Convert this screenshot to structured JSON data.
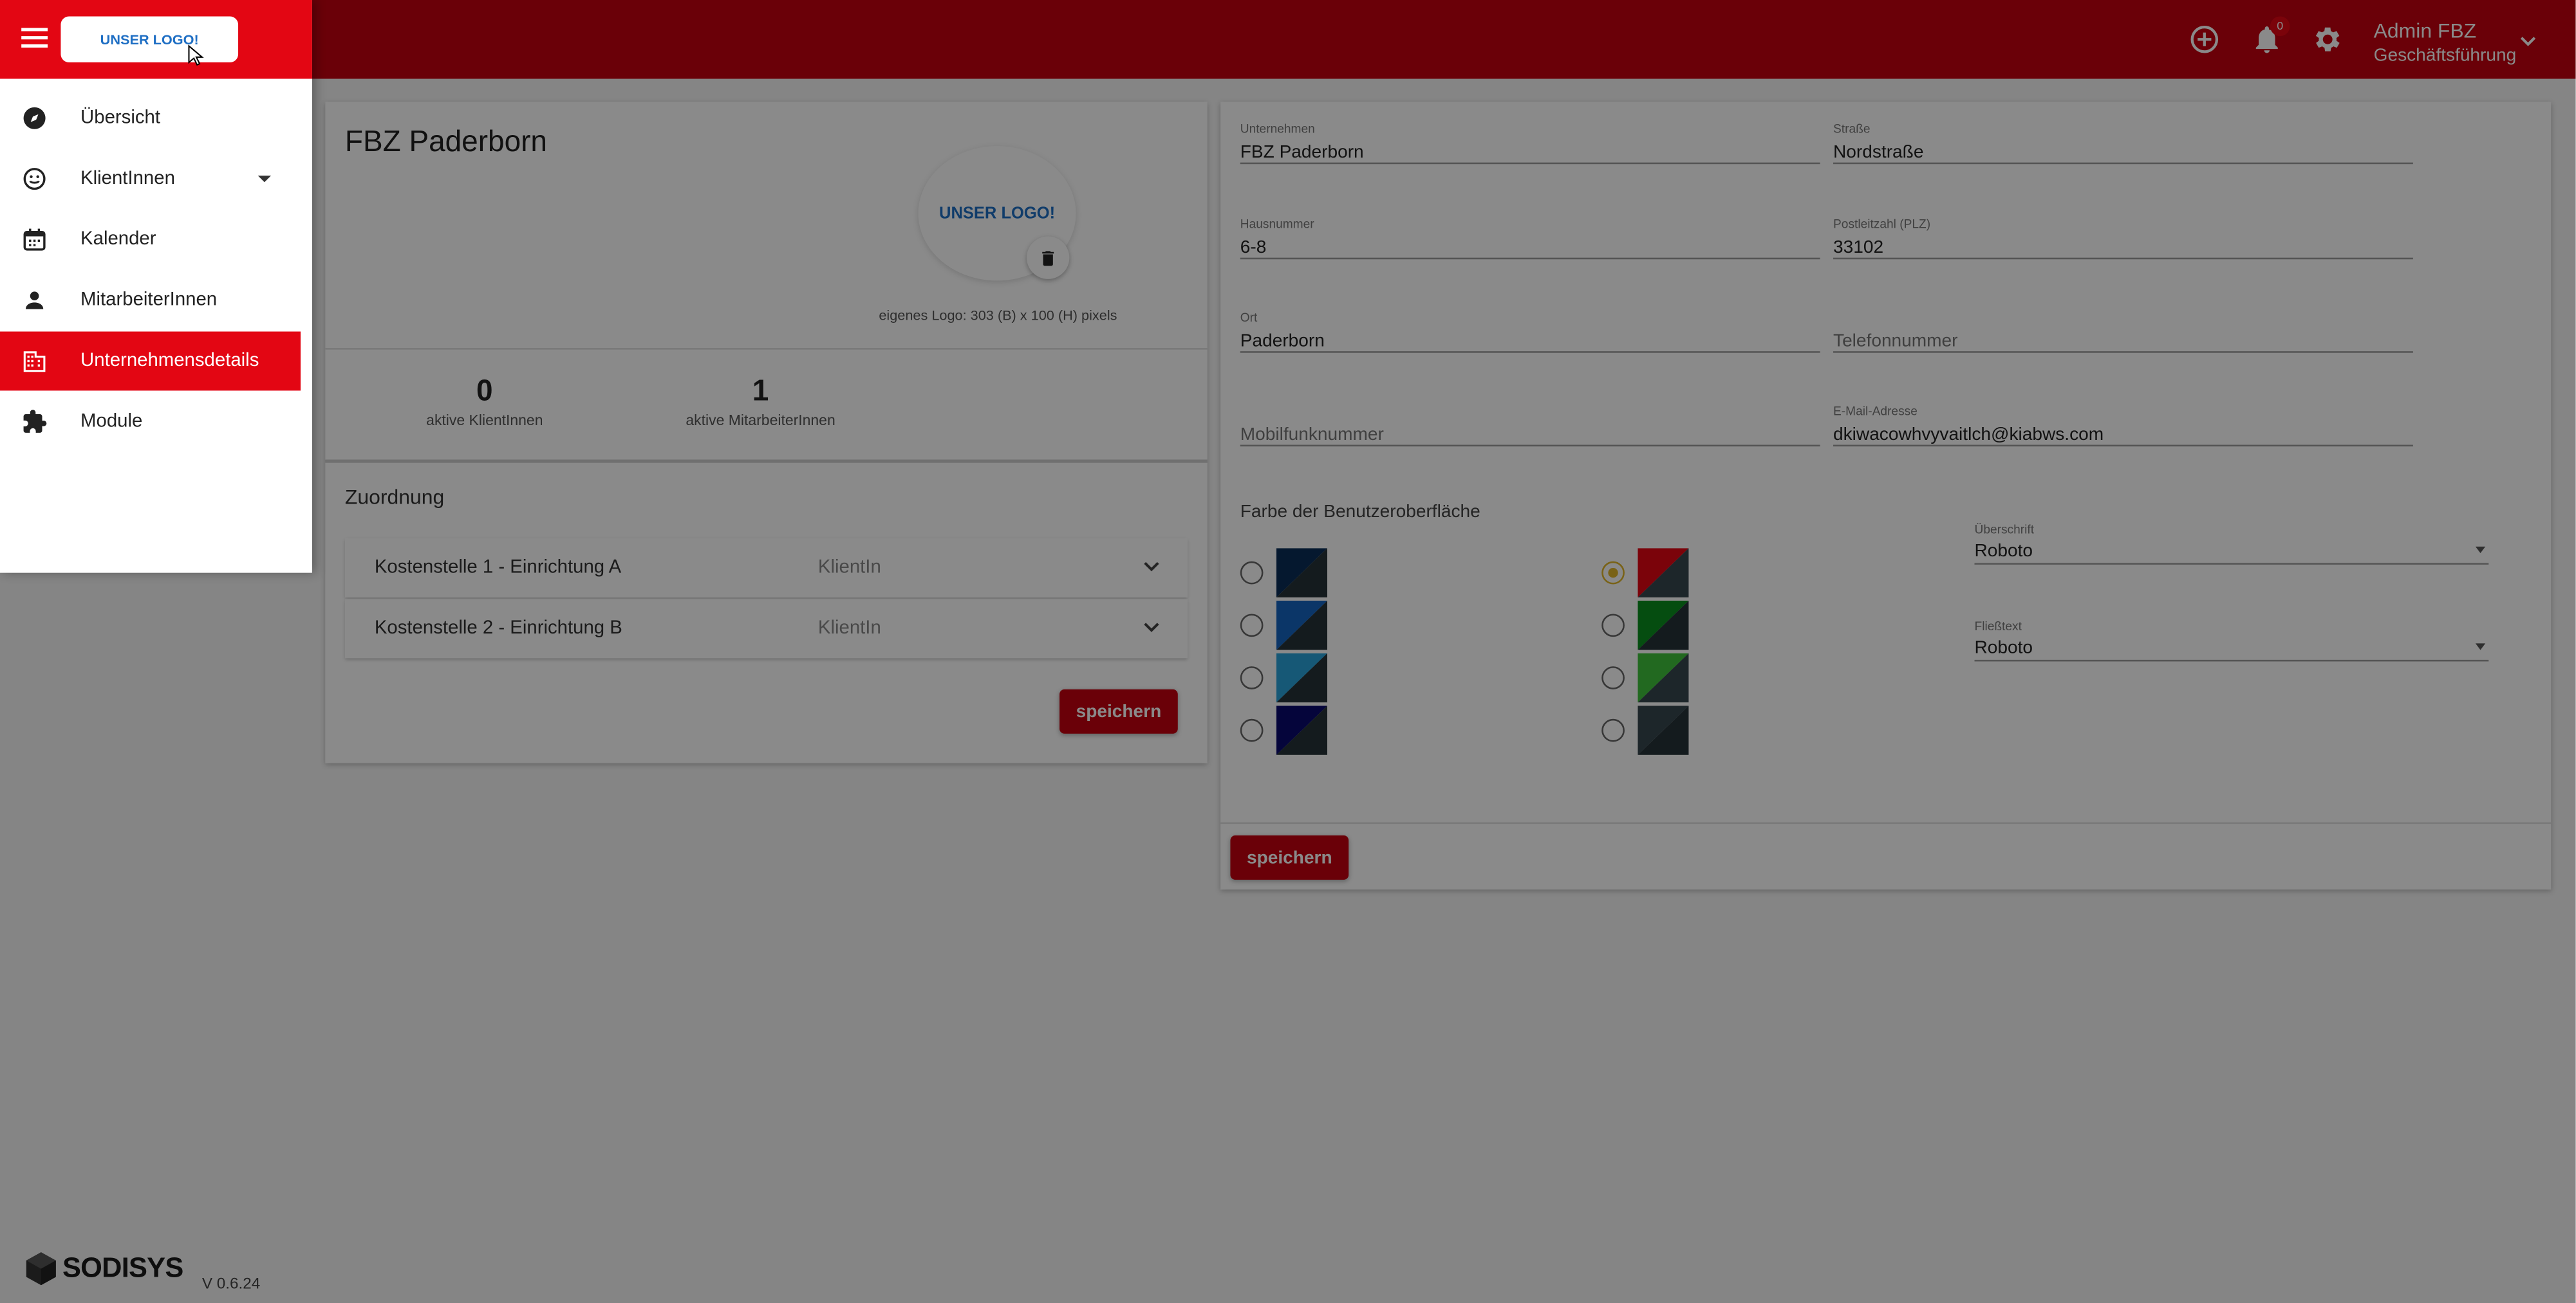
{
  "app": {
    "logo_text": "UNSER LOGO!",
    "brand_name": "SODISYS",
    "version": "V 0.6.24"
  },
  "topbar": {
    "notification_count": "0",
    "user_name": "Admin FBZ",
    "user_role": "Geschäftsführung",
    "icons": [
      "add-circle-icon",
      "bell-icon",
      "gear-icon",
      "chevron-down-icon"
    ]
  },
  "sidebar": {
    "items": [
      {
        "label": "Übersicht",
        "icon": "compass-icon",
        "active": false
      },
      {
        "label": "KlientInnen",
        "icon": "smiley-icon",
        "active": false,
        "has_submenu": true
      },
      {
        "label": "Kalender",
        "icon": "calendar-icon",
        "active": false
      },
      {
        "label": "MitarbeiterInnen",
        "icon": "person-icon",
        "active": false
      },
      {
        "label": "Unternehmensdetails",
        "icon": "building-icon",
        "active": true
      },
      {
        "label": "Module",
        "icon": "puzzle-icon",
        "active": false
      }
    ]
  },
  "company": {
    "name": "FBZ Paderborn",
    "logo_text": "UNSER LOGO!",
    "logo_hint": "eigenes Logo: 303 (B) x 100 (H) pixels",
    "stats": [
      {
        "value": "0",
        "label": "aktive KlientInnen"
      },
      {
        "value": "1",
        "label": "aktive MitarbeiterInnen"
      }
    ],
    "assignment_title": "Zuordnung",
    "assignments": [
      {
        "name": "Kostenstelle 1 - Einrichtung A",
        "role": "KlientIn"
      },
      {
        "name": "Kostenstelle 2 - Einrichtung B",
        "role": "KlientIn"
      }
    ],
    "save_label": "speichern"
  },
  "form": {
    "fields": {
      "unternehmen": {
        "label": "Unternehmen",
        "value": "FBZ Paderborn"
      },
      "strasse": {
        "label": "Straße",
        "value": "Nordstraße"
      },
      "hausnummer": {
        "label": "Hausnummer",
        "value": "6-8"
      },
      "plz": {
        "label": "Postleitzahl (PLZ)",
        "value": "33102"
      },
      "ort": {
        "label": "Ort",
        "value": "Paderborn"
      },
      "telefon": {
        "label": "",
        "placeholder": "Telefonnummer"
      },
      "mobil": {
        "label": "",
        "placeholder": "Mobilfunknummer"
      },
      "email": {
        "label": "E-Mail-Adresse",
        "value": "dkiwacowhvyvaitlch@kiabws.com"
      }
    },
    "color_title": "Farbe der Benutzeroberfläche",
    "color_options": [
      {
        "primary": "#0b2e57",
        "secondary": "#263238",
        "selected": false
      },
      {
        "primary": "#1565c0",
        "secondary": "#263238",
        "selected": false
      },
      {
        "primary": "#29a3db",
        "secondary": "#263238",
        "selected": false
      },
      {
        "primary": "#0b0b6e",
        "secondary": "#263238",
        "selected": false
      },
      {
        "primary": "#e30613",
        "secondary": "#37474f",
        "selected": true
      },
      {
        "primary": "#0a8f1f",
        "secondary": "#263238",
        "selected": false
      },
      {
        "primary": "#3fc33b",
        "secondary": "#37474f",
        "selected": false
      },
      {
        "primary": "#37474f",
        "secondary": "#263238",
        "selected": false
      }
    ],
    "heading_font": {
      "label": "Überschrift",
      "value": "Roboto"
    },
    "body_font": {
      "label": "Fließtext",
      "value": "Roboto"
    },
    "save_label": "speichern"
  },
  "colors": {
    "accent": "#e30613",
    "topbar": "#c4000f",
    "radio_selected": "#e0b62a"
  }
}
